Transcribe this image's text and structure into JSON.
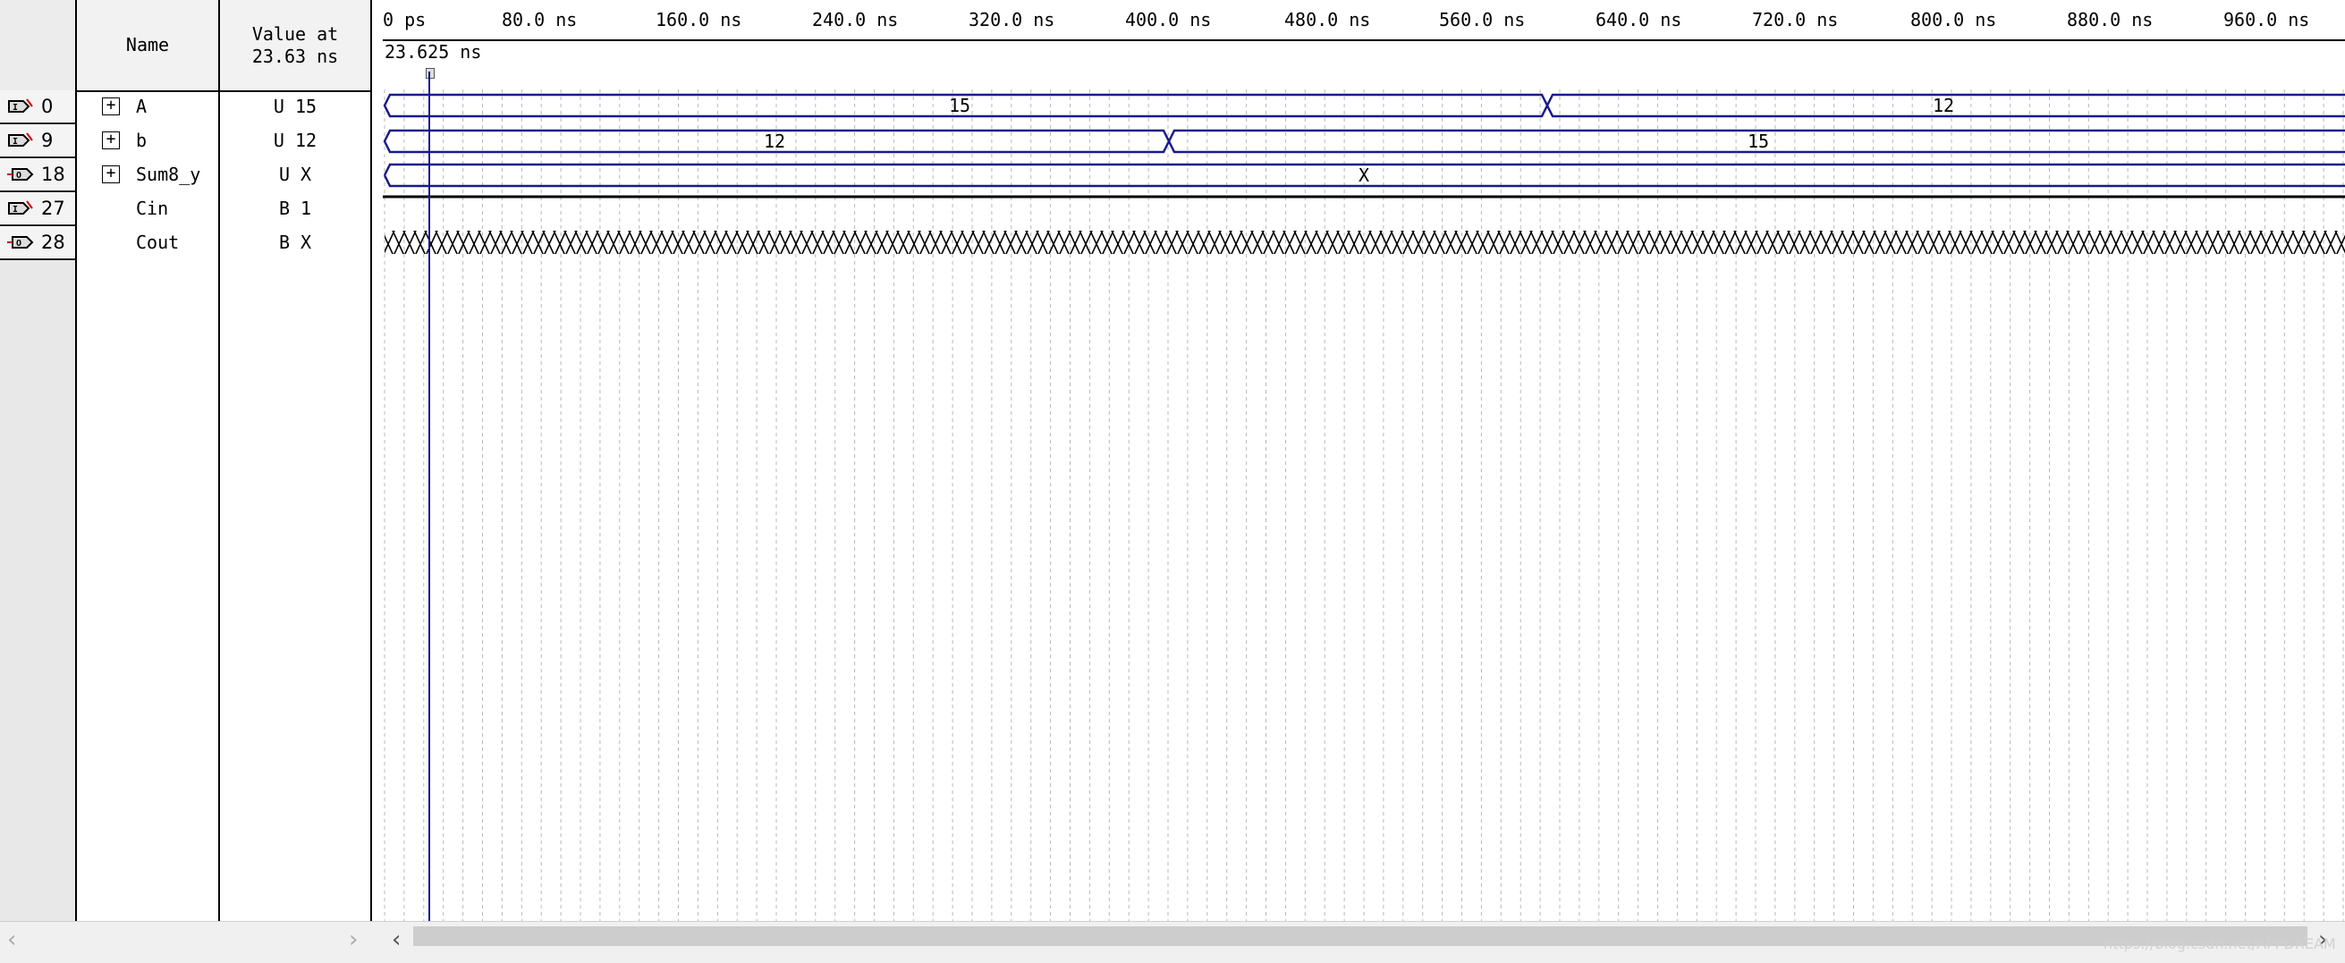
{
  "headers": {
    "name": "Name",
    "value_line1": "Value at",
    "value_line2": "23.63 ns"
  },
  "signals": [
    {
      "index": "0",
      "icon": "input-pin-icon",
      "expandable": true,
      "name": "A",
      "value": "U 15"
    },
    {
      "index": "9",
      "icon": "input-pin-icon",
      "expandable": true,
      "name": "b",
      "value": "U 12"
    },
    {
      "index": "18",
      "icon": "output-pin-icon",
      "expandable": true,
      "name": "Sum8_y",
      "value": "U X"
    },
    {
      "index": "27",
      "icon": "input-pin-icon",
      "expandable": false,
      "name": "Cin",
      "value": "B 1"
    },
    {
      "index": "28",
      "icon": "output-pin-icon",
      "expandable": false,
      "name": "Cout",
      "value": "B X"
    }
  ],
  "expand_glyph": "+",
  "time_ruler": {
    "ticks": [
      "0 ps",
      "80.0 ns",
      "160.0 ns",
      "240.0 ns",
      "320.0 ns",
      "400.0 ns",
      "480.0 ns",
      "560.0 ns",
      "640.0 ns",
      "720.0 ns",
      "800.0 ns",
      "880.0 ns",
      "960.0 ns"
    ],
    "cursor_readout": "23.625 ns"
  },
  "waveforms": {
    "A": {
      "segments": [
        {
          "label": "15"
        },
        {
          "label": "12"
        }
      ]
    },
    "b": {
      "segments": [
        {
          "label": "12"
        },
        {
          "label": "15"
        }
      ]
    },
    "Sum8_y": {
      "segments": [
        {
          "label": "X"
        }
      ]
    }
  },
  "scrollbar": {
    "left_arrow": "‹",
    "right_arrow": "›"
  },
  "watermark": "https://blog.csdn.net/APPDREAM",
  "colors": {
    "signal_line": "#1a1a8c",
    "grid": "#b8b8b8",
    "cursor": "#1a1a8c"
  }
}
